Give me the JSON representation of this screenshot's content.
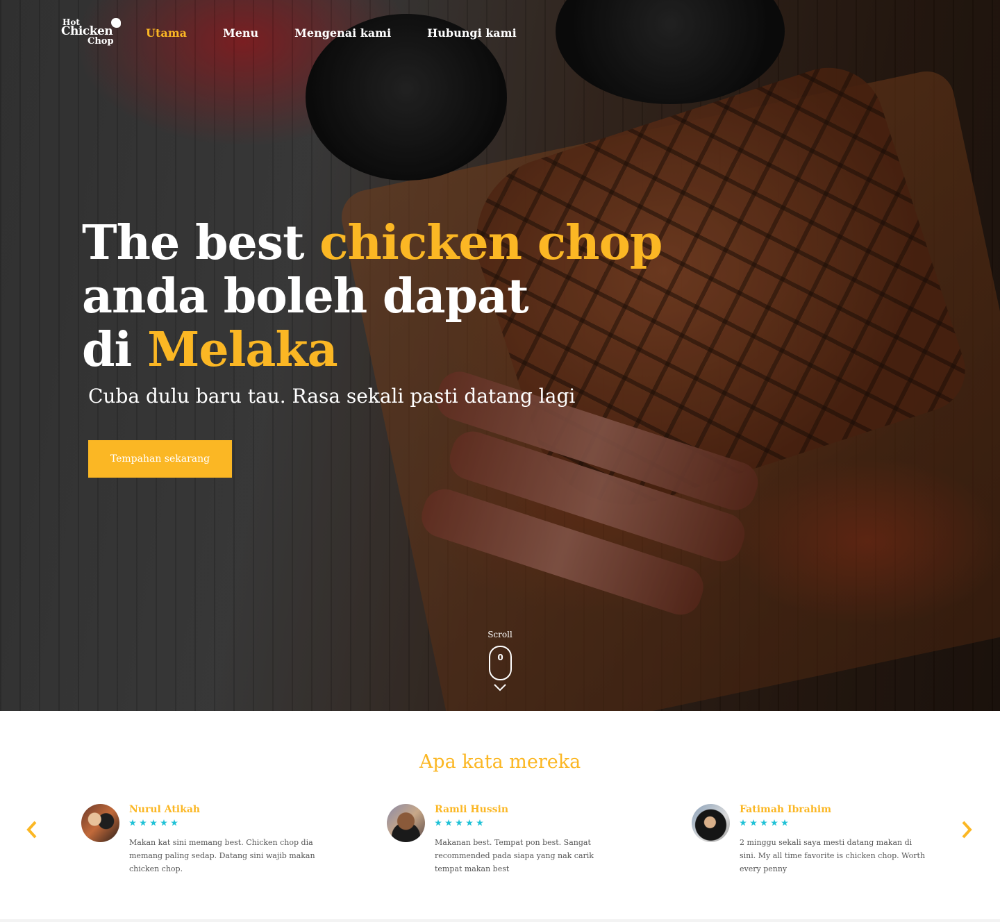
{
  "brand": {
    "logo_line1": "Hot",
    "logo_line2": "Chicken",
    "logo_line3": "Chop",
    "accent_color": "#fbb724",
    "star_color": "#1fc1d6"
  },
  "nav": {
    "items": [
      {
        "label": "Utama",
        "active": true
      },
      {
        "label": "Menu",
        "active": false
      },
      {
        "label": "Mengenai kami",
        "active": false
      },
      {
        "label": "Hubungi kami",
        "active": false
      }
    ]
  },
  "hero": {
    "headline_part1": "The best ",
    "headline_highlight1": "chicken chop",
    "headline_part2": "anda boleh dapat",
    "headline_part3": "di ",
    "headline_highlight2": "Melaka",
    "subline": "Cuba dulu baru tau. Rasa sekali pasti datang lagi",
    "cta_label": "Tempahan sekarang",
    "scroll_label": "Scroll",
    "scroll_counter": "0"
  },
  "testimonials": {
    "title": "Apa kata mereka",
    "items": [
      {
        "name": "Nurul Atikah",
        "rating": 5,
        "text": "Makan kat sini memang best. Chicken chop dia memang paling sedap. Datang sini wajib makan chicken chop."
      },
      {
        "name": "Ramli Hussin",
        "rating": 5,
        "text": "Makanan best. Tempat pon best. Sangat recommended pada siapa yang nak carik tempat makan best"
      },
      {
        "name": "Fatimah Ibrahim",
        "rating": 5,
        "text": "2 minggu sekali saya mesti datang makan di sini. My all time favorite is chicken chop. Worth every penny"
      }
    ]
  }
}
